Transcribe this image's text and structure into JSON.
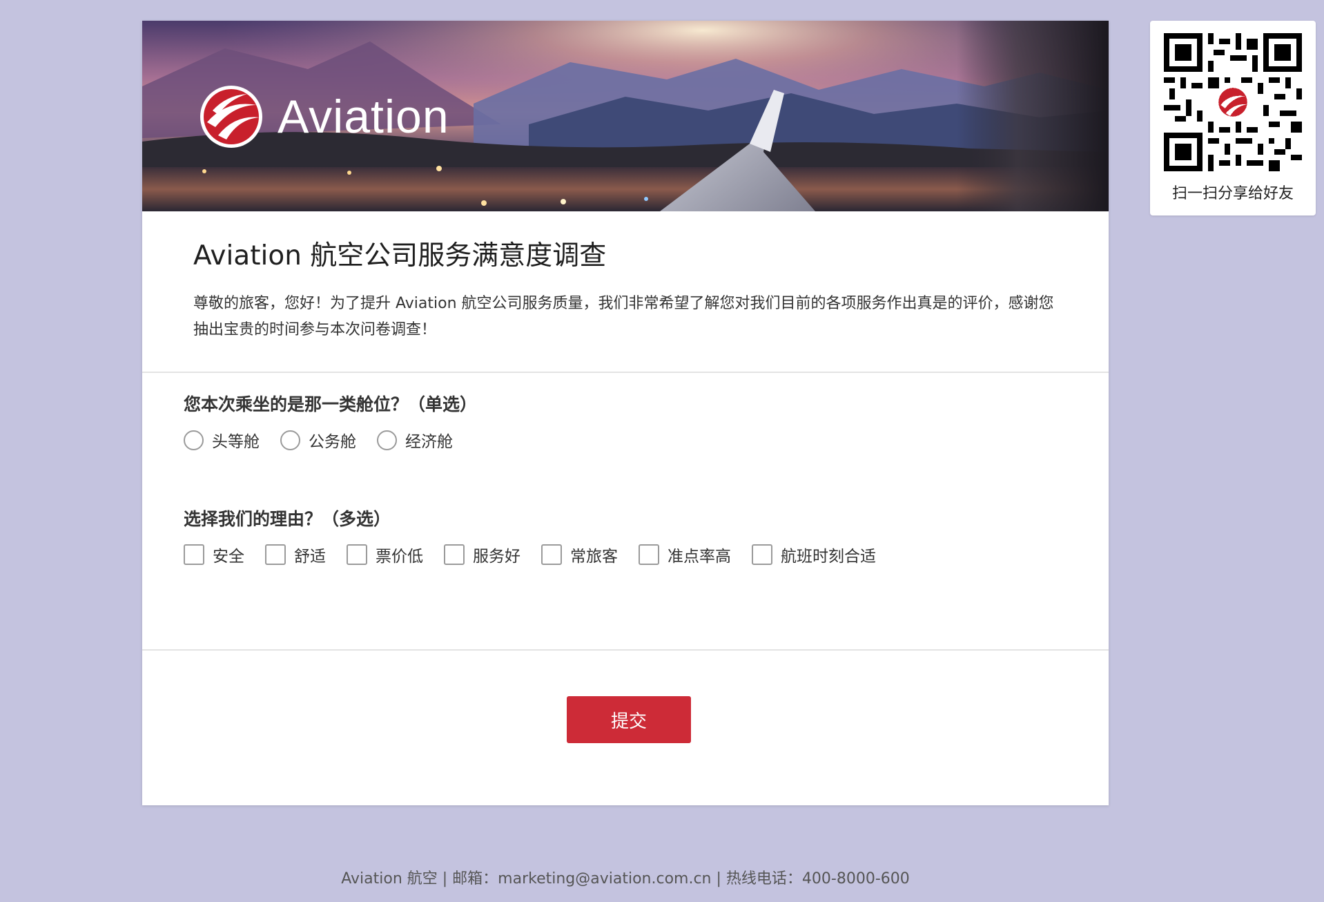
{
  "banner": {
    "brand_name": "Aviation"
  },
  "survey": {
    "title": "Aviation 航空公司服务满意度调查",
    "description": "尊敬的旅客，您好！为了提升 Aviation 航空公司服务质量，我们非常希望了解您对我们目前的各项服务作出真是的评价，感谢您抽出宝贵的时间参与本次问卷调查！"
  },
  "questions": [
    {
      "title": "您本次乘坐的是那一类舱位？（单选）",
      "type": "radio",
      "options": [
        "头等舱",
        "公务舱",
        "经济舱"
      ]
    },
    {
      "title": "选择我们的理由？（多选）",
      "type": "checkbox",
      "options": [
        "安全",
        "舒适",
        "票价低",
        "服务好",
        "常旅客",
        "准点率高",
        "航班时刻合适"
      ]
    }
  ],
  "submit_label": "提交",
  "qr": {
    "caption": "扫一扫分享给好友",
    "icon": "qr-code-icon"
  },
  "footer": "Aviation 航空 | 邮箱：marketing@aviation.com.cn | 热线电话：400-8000-600",
  "colors": {
    "background": "#c4c3df",
    "accent": "#cd2b37",
    "card": "#ffffff"
  }
}
